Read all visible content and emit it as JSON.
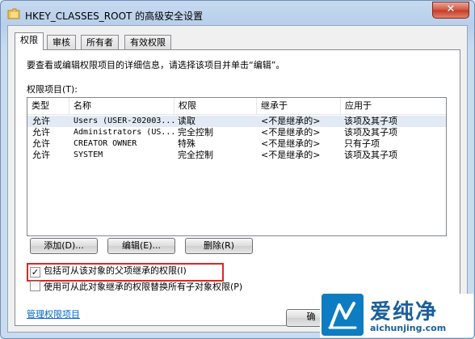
{
  "window": {
    "title": "HKEY_CLASSES_ROOT 的高级安全设置",
    "close_glyph": "✕"
  },
  "tabs": [
    {
      "label": "权限"
    },
    {
      "label": "审核"
    },
    {
      "label": "所有者"
    },
    {
      "label": "有效权限"
    }
  ],
  "instruction": "要查看或编辑权限项目的详细信息，请选择该项目并单击“编辑”。",
  "permissions_label": "权限项目(T):",
  "table": {
    "columns": [
      "类型",
      "名称",
      "权限",
      "继承于",
      "应用于"
    ],
    "rows": [
      {
        "type": "允许",
        "name": "Users (USER-202003...",
        "permission": "读取",
        "inherited": "<不是继承的>",
        "applies": "该项及其子项"
      },
      {
        "type": "允许",
        "name": "Administrators (US...",
        "permission": "完全控制",
        "inherited": "<不是继承的>",
        "applies": "该项及其子项"
      },
      {
        "type": "允许",
        "name": "CREATOR OWNER",
        "permission": "特殊",
        "inherited": "<不是继承的>",
        "applies": "只有子项"
      },
      {
        "type": "允许",
        "name": "SYSTEM",
        "permission": "完全控制",
        "inherited": "<不是继承的>",
        "applies": "该项及其子项"
      }
    ]
  },
  "buttons": {
    "add": "添加(D)...",
    "edit": "编辑(E)...",
    "remove": "删除(R)",
    "ok": "确"
  },
  "checkboxes": {
    "include_inheritable": {
      "label": "包括可从该对象的父项继承的权限(I)",
      "checked": true,
      "mark": "✓"
    },
    "replace_child": {
      "label": "使用可从此对象继承的权限替换所有子对象权限(P)",
      "checked": false,
      "mark": ""
    }
  },
  "manage_link": "管理权限项目",
  "watermark": {
    "name": "爱纯净",
    "url": "aichunjing.com"
  },
  "colors": {
    "highlight": "#e02424",
    "link": "#0066cc",
    "watermark_blue": "#1a5f9c"
  }
}
